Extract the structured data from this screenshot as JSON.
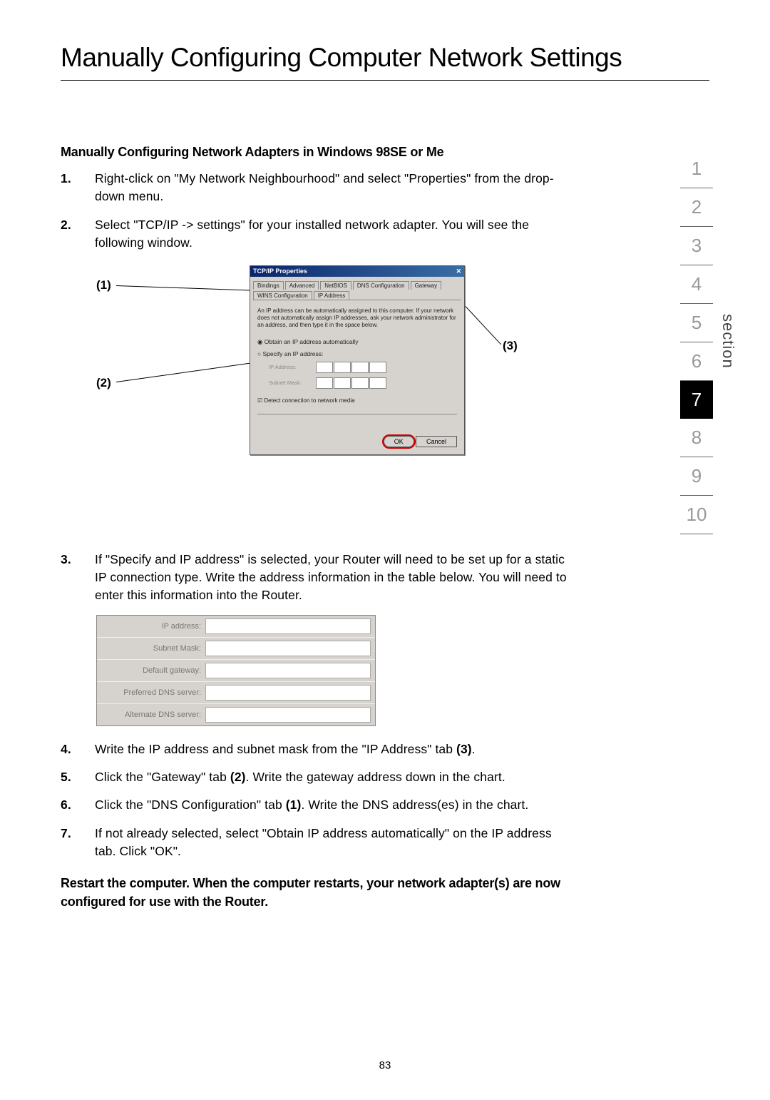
{
  "title": "Manually Configuring Computer Network Settings",
  "subheading": "Manually Configuring Network Adapters in Windows 98SE or Me",
  "steps_top": [
    {
      "num": "1.",
      "text": "Right-click on \"My Network Neighbourhood\" and select \"Properties\" from the drop-down menu."
    },
    {
      "num": "2.",
      "text": "Select \"TCP/IP -> settings\" for your installed network adapter. You will see the following window."
    }
  ],
  "callouts": {
    "c1": "(1)",
    "c2": "(2)",
    "c3": "(3)"
  },
  "dialog": {
    "title": "TCP/IP Properties",
    "close_glyph": "✕",
    "tabs_row1": [
      "Bindings",
      "Advanced",
      "NetBIOS"
    ],
    "tabs_row2": [
      "DNS Configuration",
      "Gateway",
      "WINS Configuration",
      "IP Address"
    ],
    "desc": "An IP address can be automatically assigned to this computer. If your network does not automatically assign IP addresses, ask your network administrator for an address, and then type it in the space below.",
    "radio1": "Obtain an IP address automatically",
    "radio2": "Specify an IP address:",
    "field1": "IP Address:",
    "field2": "Subnet Mask:",
    "checkbox": "Detect connection to network media",
    "ok": "OK",
    "cancel": "Cancel"
  },
  "step3": {
    "num": "3.",
    "text": "If \"Specify and IP address\" is selected, your Router will need to be set up for a static IP connection type. Write the address information in the table below. You will need to enter this information into the Router."
  },
  "table_labels": [
    "IP address:",
    "Subnet Mask:",
    "Default gateway:",
    "Preferred DNS server:",
    "Alternate DNS server:"
  ],
  "steps_bottom": [
    {
      "num": "4.",
      "pre": "Write the IP address and subnet mask from the \"IP Address\" tab ",
      "bold": "(3)",
      "post": "."
    },
    {
      "num": "5.",
      "pre": "Click the \"Gateway\" tab ",
      "bold": "(2)",
      "post": ". Write the gateway address down in the chart."
    },
    {
      "num": "6.",
      "pre": "Click the \"DNS Configuration\" tab ",
      "bold": "(1)",
      "post": ". Write the DNS address(es) in the chart."
    },
    {
      "num": "7.",
      "pre": "If not already selected, select \"Obtain IP address automatically\" on the IP address tab. Click \"OK\".",
      "bold": "",
      "post": ""
    }
  ],
  "restart": "Restart the computer. When the computer restarts, your network adapter(s) are now configured for use with the Router.",
  "page_number": "83",
  "section_label": "section",
  "section_nav": [
    "1",
    "2",
    "3",
    "4",
    "5",
    "6",
    "7",
    "8",
    "9",
    "10"
  ],
  "active_section": "7"
}
